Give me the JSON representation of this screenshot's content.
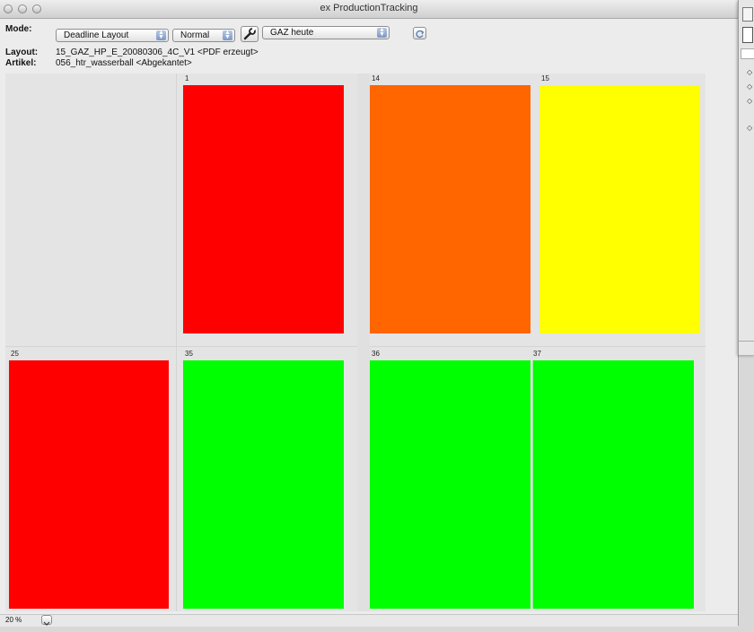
{
  "window": {
    "title": "ex ProductionTracking"
  },
  "toolbar": {
    "mode_label": "Mode:",
    "mode_value": "Deadline Layout",
    "view_value": "Normal",
    "issue_value": "GAZ heute",
    "layout_label": "Layout:",
    "layout_value": "15_GAZ_HP_E_20080306_4C_V1 <PDF erzeugt>",
    "article_label": "Artikel:",
    "article_value": "056_htr_wasserball <Abgekantet>"
  },
  "pages": [
    {
      "number": "1",
      "status": "red"
    },
    {
      "number": "14",
      "status": "orange"
    },
    {
      "number": "15",
      "status": "yellow"
    },
    {
      "number": "25",
      "status": "red"
    },
    {
      "number": "35",
      "status": "green"
    },
    {
      "number": "36",
      "status": "green"
    },
    {
      "number": "37",
      "status": "green"
    }
  ],
  "colors": {
    "red": "#ff0000",
    "orange": "#ff6600",
    "yellow": "#ffff00",
    "green": "#00ff00"
  },
  "status_bar": {
    "zoom": "20 %"
  },
  "icons": {
    "settings": "wrench-icon",
    "refresh": "refresh-icon"
  }
}
